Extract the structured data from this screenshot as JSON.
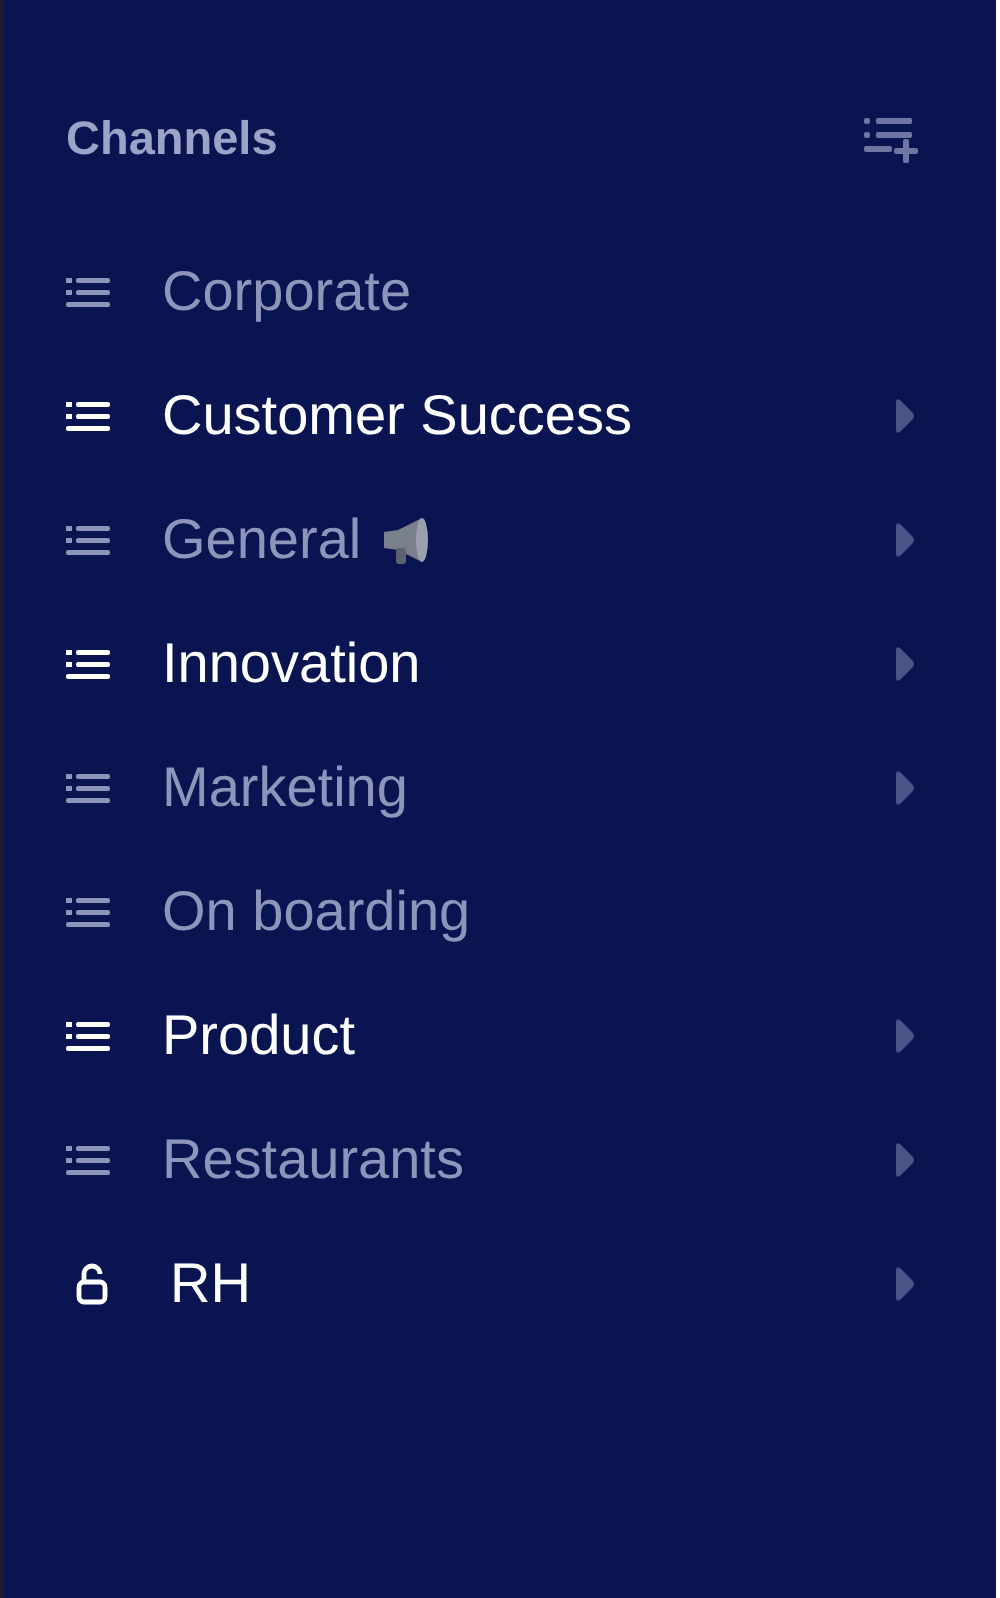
{
  "sidebar": {
    "title": "Channels",
    "channels": [
      {
        "name": "Corporate",
        "kind": "list",
        "unread": false,
        "expandable": false,
        "announcement": false
      },
      {
        "name": "Customer Success",
        "kind": "list",
        "unread": true,
        "expandable": true,
        "announcement": false
      },
      {
        "name": "General",
        "kind": "list",
        "unread": false,
        "expandable": true,
        "announcement": true
      },
      {
        "name": "Innovation",
        "kind": "list",
        "unread": true,
        "expandable": true,
        "announcement": false
      },
      {
        "name": "Marketing",
        "kind": "list",
        "unread": false,
        "expandable": true,
        "announcement": false
      },
      {
        "name": "On boarding",
        "kind": "list",
        "unread": false,
        "expandable": false,
        "announcement": false
      },
      {
        "name": "Product",
        "kind": "list",
        "unread": true,
        "expandable": true,
        "announcement": false
      },
      {
        "name": "Restaurants",
        "kind": "list",
        "unread": false,
        "expandable": true,
        "announcement": false
      },
      {
        "name": "RH",
        "kind": "private",
        "unread": true,
        "expandable": true,
        "announcement": false
      }
    ]
  }
}
